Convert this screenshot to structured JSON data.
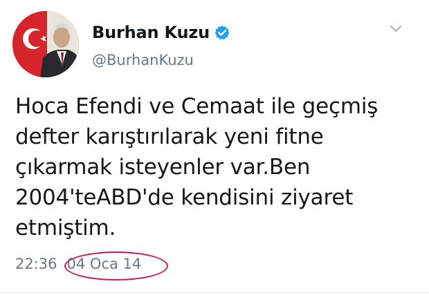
{
  "author": {
    "display_name": "Burhan Kuzu",
    "handle": "@BurhanKuzu",
    "verified": true,
    "avatar_icon": "profile-photo"
  },
  "tweet": {
    "text": "Hoca Efendi ve Cemaat ile geçmiş\ndefter karıştırılarak yeni fitne\nçıkarmak isteyenler var.Ben\n2004'teABD'de kendisini ziyaret\netmiştim.",
    "time": "22:36",
    "date": "04 Oca 14"
  },
  "icons": {
    "verified": "verified-badge-icon",
    "menu": "chevron-down-icon"
  },
  "colors": {
    "text": "#14171a",
    "secondary": "#657786",
    "verified_blue": "#1da1f2",
    "annotation_ring": "#c4185c",
    "flag_red": "#d7262b"
  }
}
